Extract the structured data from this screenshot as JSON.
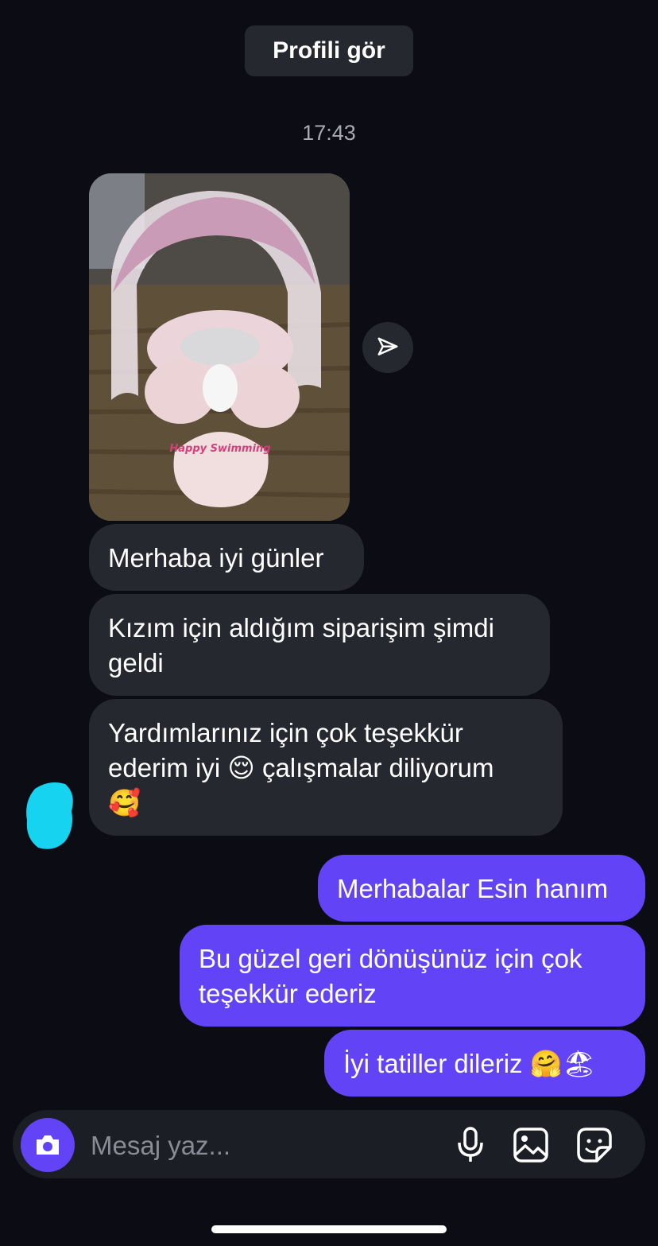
{
  "header": {
    "profile_button": "Profili gör"
  },
  "thread": {
    "timestamp": "17:43",
    "incoming": [
      {
        "text": "Merhaba iyi günler"
      },
      {
        "text": "Kızım için aldığım siparişim şimdi geldi"
      },
      {
        "text_before": "Yardımlarınız için çok teşekkür ederim iyi ",
        "emoji_1": "😌",
        "text_after": " çalışmalar diliyorum",
        "emoji_2": "🥰"
      }
    ],
    "outgoing": [
      {
        "text": "Merhabalar Esin hanım"
      },
      {
        "text": "Bu güzel geri dönüşünüz için çok teşekkür ederiz"
      },
      {
        "text": "İyi tatiller dileriz ",
        "emoji_1": "🤗",
        "emoji_2": "🏖"
      }
    ],
    "photo": {
      "caption": "Happy Swimming"
    }
  },
  "composer": {
    "placeholder": "Mesaj yaz...",
    "icons": [
      "camera-icon",
      "microphone-icon",
      "gallery-icon",
      "sticker-icon"
    ]
  },
  "colors": {
    "background": "#0b0c14",
    "incoming_bubble": "#262830",
    "outgoing_bubble": "#6244f6",
    "accent": "#6244f6",
    "avatar_scribble": "#16d4ef"
  }
}
